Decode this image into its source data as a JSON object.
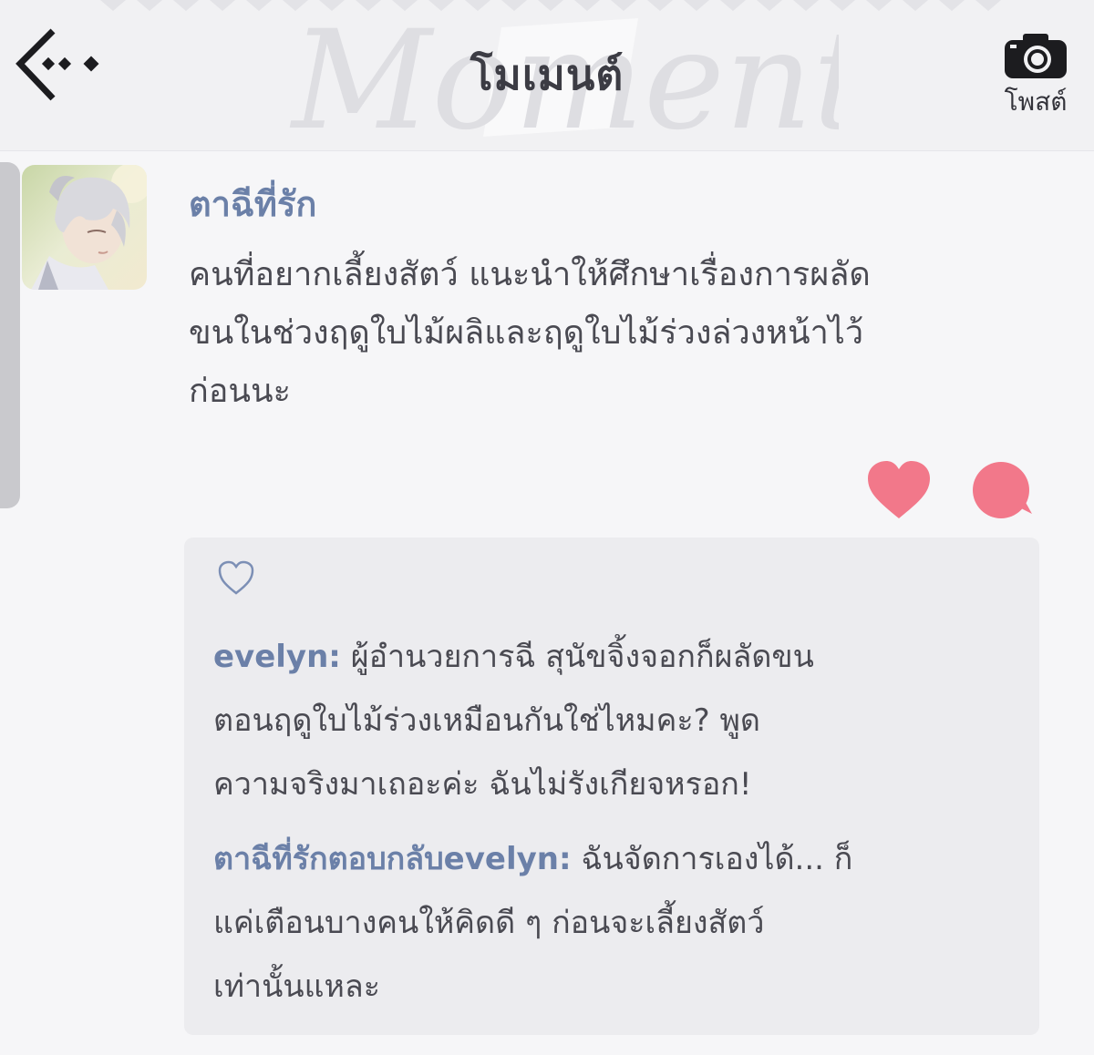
{
  "header": {
    "title": "โมเมนต์",
    "post_label": "โพสต์",
    "watermark_text": "Moments",
    "icons": {
      "back": "back-arrow-icon",
      "post": "camera-icon"
    }
  },
  "post": {
    "author": "ตาฉีที่รัก",
    "text_lines": [
      "คนที่อยากเลี้ยงสัตว์ แนะนำให้ศึกษาเรื่องการผลัด",
      "ขนในช่วงฤดูใบไม้ผลิและฤดูใบไม้ร่วงล่วงหน้าไว้",
      "ก่อนนะ"
    ],
    "icons": {
      "like": "heart-icon",
      "comment": "comment-bubble-icon"
    }
  },
  "comments": [
    {
      "name": "evelyn:",
      "first": " ผู้อำนวยการฉี สุนัขจิ้งจอกก็ผลัดขน",
      "rest": [
        "ตอนฤดูใบไม้ร่วงเหมือนกันใช่ไหมคะ? พูด",
        "ความจริงมาเถอะค่ะ ฉันไม่รังเกียจหรอก!"
      ]
    },
    {
      "name": "ตาฉีที่รักตอบกลับevelyn:",
      "first": " ฉันจัดการเองได้... ก็",
      "rest": [
        "แค่เตือนบางคนให้คิดดี ๆ ก่อนจะเลี้ยงสัตว์",
        "เท่านั้นแหละ"
      ]
    }
  ],
  "colors": {
    "accent_name": "#6b80a8",
    "heart": "#f2788a",
    "text": "#4a4a52",
    "panel": "#ececef"
  }
}
